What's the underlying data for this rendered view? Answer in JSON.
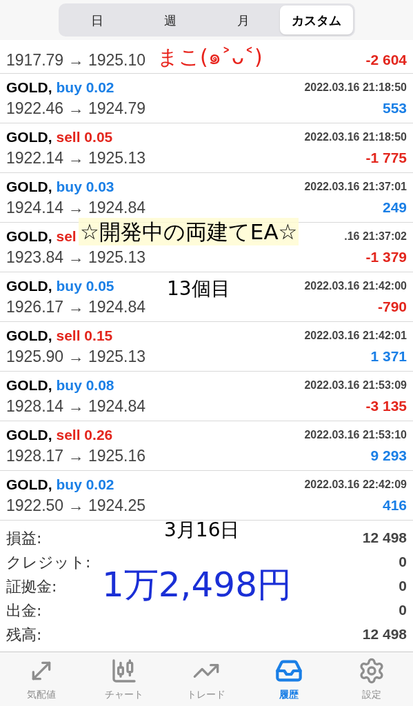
{
  "period_tabs": [
    {
      "label": "日",
      "selected": false
    },
    {
      "label": "週",
      "selected": false
    },
    {
      "label": "月",
      "selected": false
    },
    {
      "label": "カスタム",
      "selected": true
    }
  ],
  "trades": [
    {
      "kind": "partial",
      "prices": "1917.79 → 1925.10",
      "profit": {
        "text": "-2 604",
        "color": "#e3261d"
      }
    },
    {
      "kind": "full",
      "symbol": "GOLD,",
      "action": {
        "text": "buy 0.02",
        "color": "#1a7fe6"
      },
      "date": "2022.03.16 21:18:50",
      "prices": "1922.46 → 1924.79",
      "profit": {
        "text": "553",
        "color": "#1a7fe6"
      }
    },
    {
      "kind": "full",
      "symbol": "GOLD,",
      "action": {
        "text": "sell 0.05",
        "color": "#e3261d"
      },
      "date": "2022.03.16 21:18:50",
      "prices": "1922.14 → 1925.13",
      "profit": {
        "text": "-1 775",
        "color": "#e3261d"
      }
    },
    {
      "kind": "full",
      "symbol": "GOLD,",
      "action": {
        "text": "buy 0.03",
        "color": "#1a7fe6"
      },
      "date": "2022.03.16 21:37:01",
      "prices": "1924.14 → 1924.84",
      "profit": {
        "text": "249",
        "color": "#1a7fe6"
      }
    },
    {
      "kind": "full",
      "symbol": "GOLD,",
      "action": {
        "text": "sel",
        "color": "#e3261d"
      },
      "date": ".16 21:37:02",
      "prices": "1923.84 → 1925.13",
      "profit": {
        "text": "-1 379",
        "color": "#e3261d"
      }
    },
    {
      "kind": "full",
      "symbol": "GOLD,",
      "action": {
        "text": "buy 0.05",
        "color": "#1a7fe6"
      },
      "date": "2022.03.16 21:42:00",
      "prices": "1926.17 → 1924.84",
      "profit": {
        "text": "-790",
        "color": "#e3261d"
      }
    },
    {
      "kind": "full",
      "symbol": "GOLD,",
      "action": {
        "text": "sell 0.15",
        "color": "#e3261d"
      },
      "date": "2022.03.16 21:42:01",
      "prices": "1925.90 → 1925.13",
      "profit": {
        "text": "1 371",
        "color": "#1a7fe6"
      }
    },
    {
      "kind": "full",
      "symbol": "GOLD,",
      "action": {
        "text": "buy 0.08",
        "color": "#1a7fe6"
      },
      "date": "2022.03.16 21:53:09",
      "prices": "1928.14 → 1924.84",
      "profit": {
        "text": "-3 135",
        "color": "#e3261d"
      }
    },
    {
      "kind": "full",
      "symbol": "GOLD,",
      "action": {
        "text": "sell 0.26",
        "color": "#e3261d"
      },
      "date": "2022.03.16 21:53:10",
      "prices": "1928.17 → 1925.16",
      "profit": {
        "text": "9 293",
        "color": "#1a7fe6"
      }
    },
    {
      "kind": "full",
      "symbol": "GOLD,",
      "action": {
        "text": "buy 0.02",
        "color": "#1a7fe6"
      },
      "date": "2022.03.16 22:42:09",
      "prices": "1922.50 → 1924.25",
      "profit": {
        "text": "416",
        "color": "#1a7fe6"
      }
    }
  ],
  "summary": [
    {
      "label": "損益:",
      "value": "12 498"
    },
    {
      "label": "クレジット:",
      "value": "0"
    },
    {
      "label": "証拠金:",
      "value": "0"
    },
    {
      "label": "出金:",
      "value": "0"
    },
    {
      "label": "残高:",
      "value": "12 498"
    }
  ],
  "annotations": [
    {
      "kind": "signature",
      "text": "まこ(๑˃ᴗ˂)"
    },
    {
      "kind": "banner",
      "text": "☆開発中の両建てEA☆"
    },
    {
      "kind": "count",
      "text": "13個目"
    },
    {
      "kind": "date",
      "text": "3月16日"
    },
    {
      "kind": "total",
      "text": "1万2,498円"
    }
  ],
  "bottom_nav": [
    {
      "label": "気配値",
      "kind": "quotes",
      "selected": false
    },
    {
      "label": "チャート",
      "kind": "chart",
      "selected": false
    },
    {
      "label": "トレード",
      "kind": "trade",
      "selected": false
    },
    {
      "label": "履歴",
      "kind": "history",
      "selected": true
    },
    {
      "label": "設定",
      "kind": "settings",
      "selected": false
    }
  ]
}
